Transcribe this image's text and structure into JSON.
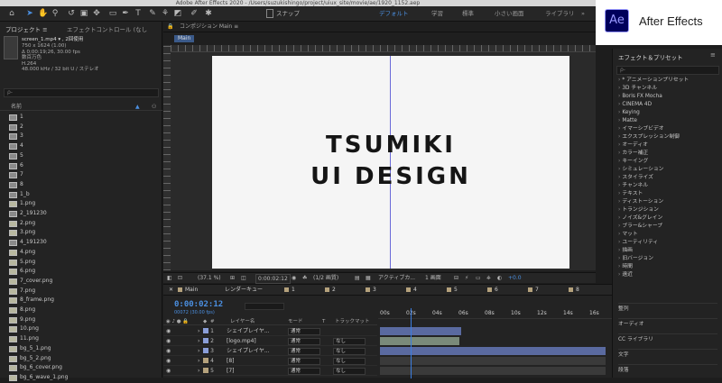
{
  "window_title": "Adobe After Effects 2020 - /Users/suzukishingo/project/uiux_site/movie/ae/1920_1152.aep",
  "app_badge": {
    "logo": "Ae",
    "name": "After Effects"
  },
  "toolbar": {
    "snap_label": "スナップ",
    "workspaces": [
      "デフォルト",
      "学習",
      "標準",
      "小さい画面",
      "ライブラリ"
    ],
    "more": "»"
  },
  "project": {
    "tab_project": "プロジェクト ≡",
    "tab_effect_controls": "エフェクトコントロール (なし",
    "footage_name": "screen_1.mp4 ▾ , 2回使用",
    "footage_info": [
      "750 x 1624 (1.00)",
      "Δ 0;00:19;26, 30.00 fps",
      "数百万色",
      "H.264",
      "48.000 kHz / 32 bit U / ステレオ"
    ],
    "search_placeholder": "ρ-",
    "column_name": "名前",
    "items": [
      {
        "name": "1",
        "type": "folder"
      },
      {
        "name": "2",
        "type": "folder"
      },
      {
        "name": "3",
        "type": "folder"
      },
      {
        "name": "4",
        "type": "folder"
      },
      {
        "name": "5",
        "type": "folder"
      },
      {
        "name": "6",
        "type": "folder"
      },
      {
        "name": "7",
        "type": "folder"
      },
      {
        "name": "8",
        "type": "folder"
      },
      {
        "name": "1_b",
        "type": "folder"
      },
      {
        "name": "1.png",
        "type": "image"
      },
      {
        "name": "2_191230",
        "type": "folder"
      },
      {
        "name": "2.png",
        "type": "image"
      },
      {
        "name": "3.png",
        "type": "image"
      },
      {
        "name": "4_191230",
        "type": "folder"
      },
      {
        "name": "4.png",
        "type": "image"
      },
      {
        "name": "5.png",
        "type": "image"
      },
      {
        "name": "6.png",
        "type": "image"
      },
      {
        "name": "7_cover.png",
        "type": "image"
      },
      {
        "name": "7.png",
        "type": "image"
      },
      {
        "name": "8_frame.png",
        "type": "image"
      },
      {
        "name": "8.png",
        "type": "image"
      },
      {
        "name": "9.png",
        "type": "image"
      },
      {
        "name": "10.png",
        "type": "image"
      },
      {
        "name": "11.png",
        "type": "image"
      },
      {
        "name": "bg_5_1.png",
        "type": "image"
      },
      {
        "name": "bg_5_2.png",
        "type": "image"
      },
      {
        "name": "bg_6_cover.png",
        "type": "image"
      },
      {
        "name": "bg_6_wave_1.png",
        "type": "image"
      }
    ]
  },
  "composition": {
    "tab_label": "コンポジション Main ≡",
    "sub_tab": "Main",
    "canvas_text_line1": "TSUMIKI",
    "canvas_text_line2": "UI DESIGN",
    "zoom": "(37.1 %)",
    "timecode": "0:00:02:12",
    "resolution": "(1/2 画質)",
    "camera": "アクティブカ...",
    "view": "1 画面",
    "exposure": "+0.0"
  },
  "effects": {
    "title": "エフェクト＆プリセット",
    "search_placeholder": "ρ-",
    "categories": [
      "* アニメーションプリセット",
      "3D チャンネル",
      "Boris FX Mocha",
      "CINEMA 4D",
      "Keying",
      "Matte",
      "イマーシブビデオ",
      "エクスプレッション制御",
      "オーディオ",
      "カラー補正",
      "キーイング",
      "シミュレーション",
      "スタイライズ",
      "チャンネル",
      "テキスト",
      "ディストーション",
      "トランジション",
      "ノイズ&グレイン",
      "ブラー&シャープ",
      "マット",
      "ユーティリティ",
      "描画",
      "旧バージョン",
      "時間",
      "遠近"
    ],
    "panels": [
      "整列",
      "オーディオ",
      "CC ライブラリ",
      "文字",
      "段落"
    ]
  },
  "timeline": {
    "main_tab": "Main",
    "render_queue": "レンダーキュー",
    "comp_tabs": [
      "1",
      "2",
      "3",
      "4",
      "5",
      "6",
      "7",
      "8"
    ],
    "timecode": "0:00:02:12",
    "fps": "00072 (30.00 fps)",
    "col_layer_name": "レイヤー名",
    "col_mode": "モード",
    "col_t": "T",
    "col_trkmat": "トラックマット",
    "ruler": [
      "00s",
      "02s",
      "04s",
      "06s",
      "08s",
      "10s",
      "12s",
      "14s",
      "16s"
    ],
    "layers": [
      {
        "num": "1",
        "name": "シェイプレイヤ...",
        "mode": "通常",
        "trkmat": "",
        "color": "#8a9ed8"
      },
      {
        "num": "2",
        "name": "[logo.mp4]",
        "mode": "通常",
        "trkmat": "なし",
        "color": "#8a9ed8"
      },
      {
        "num": "3",
        "name": "シェイプレイヤ...",
        "mode": "通常",
        "trkmat": "なし",
        "color": "#8a9ed8"
      },
      {
        "num": "4",
        "name": "[8]",
        "mode": "通常",
        "trkmat": "なし",
        "color": "#b5a27c"
      },
      {
        "num": "5",
        "name": "[7]",
        "mode": "通常",
        "trkmat": "なし",
        "color": "#b5a27c"
      }
    ]
  }
}
